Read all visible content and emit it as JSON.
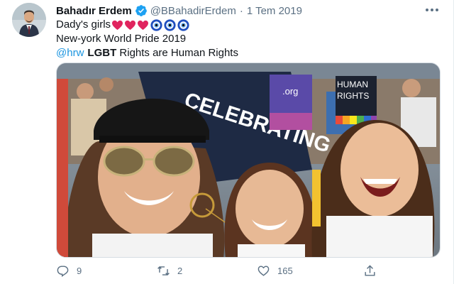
{
  "tweet": {
    "author_name": "Bahadır Erdem",
    "handle": "@BBahadirErdem",
    "separator": "·",
    "date": "1 Tem 2019",
    "lines": {
      "line1_text": "Dady's girls",
      "line2_text": "New-york World Pride 2019",
      "line3_mention": "@hrw",
      "line3_bold": "LGBT",
      "line3_rest": " Rights are Human Rights"
    },
    "icons": {
      "verified": "verified-badge-icon",
      "more": "more-options-icon",
      "hearts": "red-heart-emoji",
      "evil_eye": "nazar-evil-eye-emoji"
    },
    "media": {
      "sign_main_text": "CELEBRATING OF",
      "sign_org_text": ".org",
      "sign_human_rights": "HUMAN RIGHTS"
    },
    "actions": {
      "reply_count": "9",
      "retweet_count": "2",
      "like_count": "165"
    }
  },
  "colors": {
    "accent": "#1b95e0",
    "verified": "#1da1f2",
    "text": "#0f1419",
    "muted": "#5b7083",
    "heart": "#e0245e"
  }
}
